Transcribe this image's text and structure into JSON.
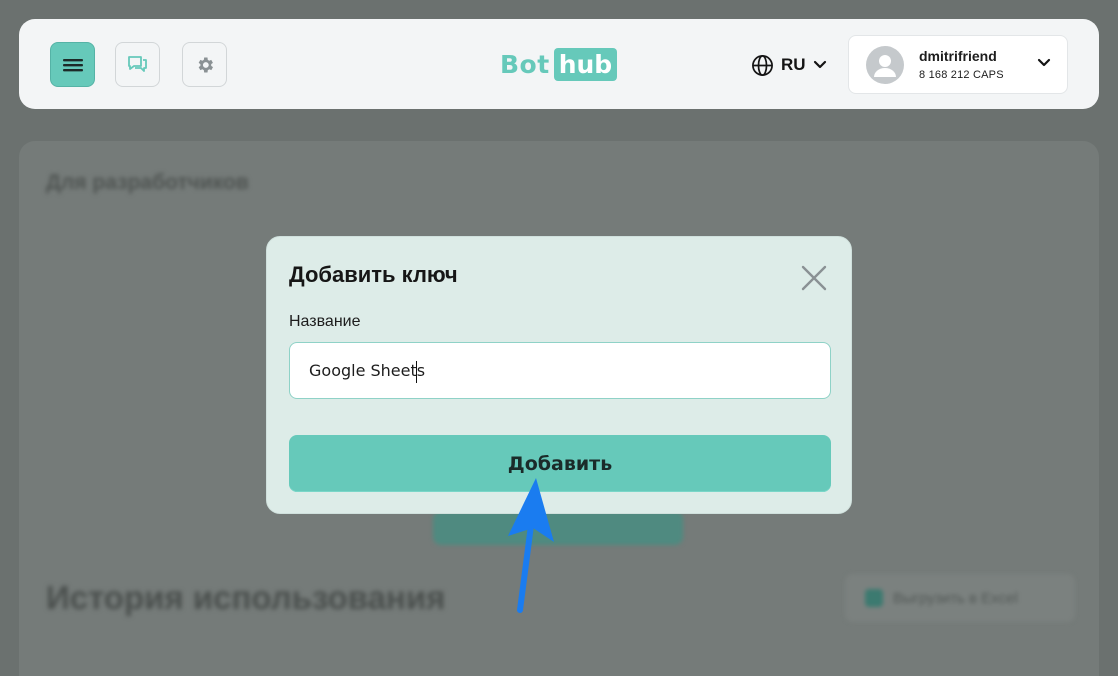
{
  "header": {
    "menu_icon": "hamburger-icon",
    "chat_icon": "chat-bubbles-icon",
    "settings_icon": "gear-icon",
    "logo": {
      "part1": "Bot",
      "part2": "hub"
    },
    "language": {
      "code": "RU",
      "icon": "globe-icon"
    },
    "user": {
      "name": "dmitrifriend",
      "balance": "8 168 212 CAPS",
      "avatar_icon": "user-avatar-icon"
    }
  },
  "background": {
    "section_title": "Для разработчиков",
    "history_title": "История использования",
    "download_button": "Выгрузить в Excel"
  },
  "modal": {
    "title": "Добавить ключ",
    "field_label": "Название",
    "field_value": "Google Sheets",
    "submit_label": "Добавить"
  },
  "annotation": {
    "type": "arrow",
    "color": "#1a7cf0",
    "points_to": "submit-button"
  },
  "colors": {
    "accent": "#66c9ba",
    "modal_bg": "#ddece8",
    "overlay": "#6b716f"
  }
}
